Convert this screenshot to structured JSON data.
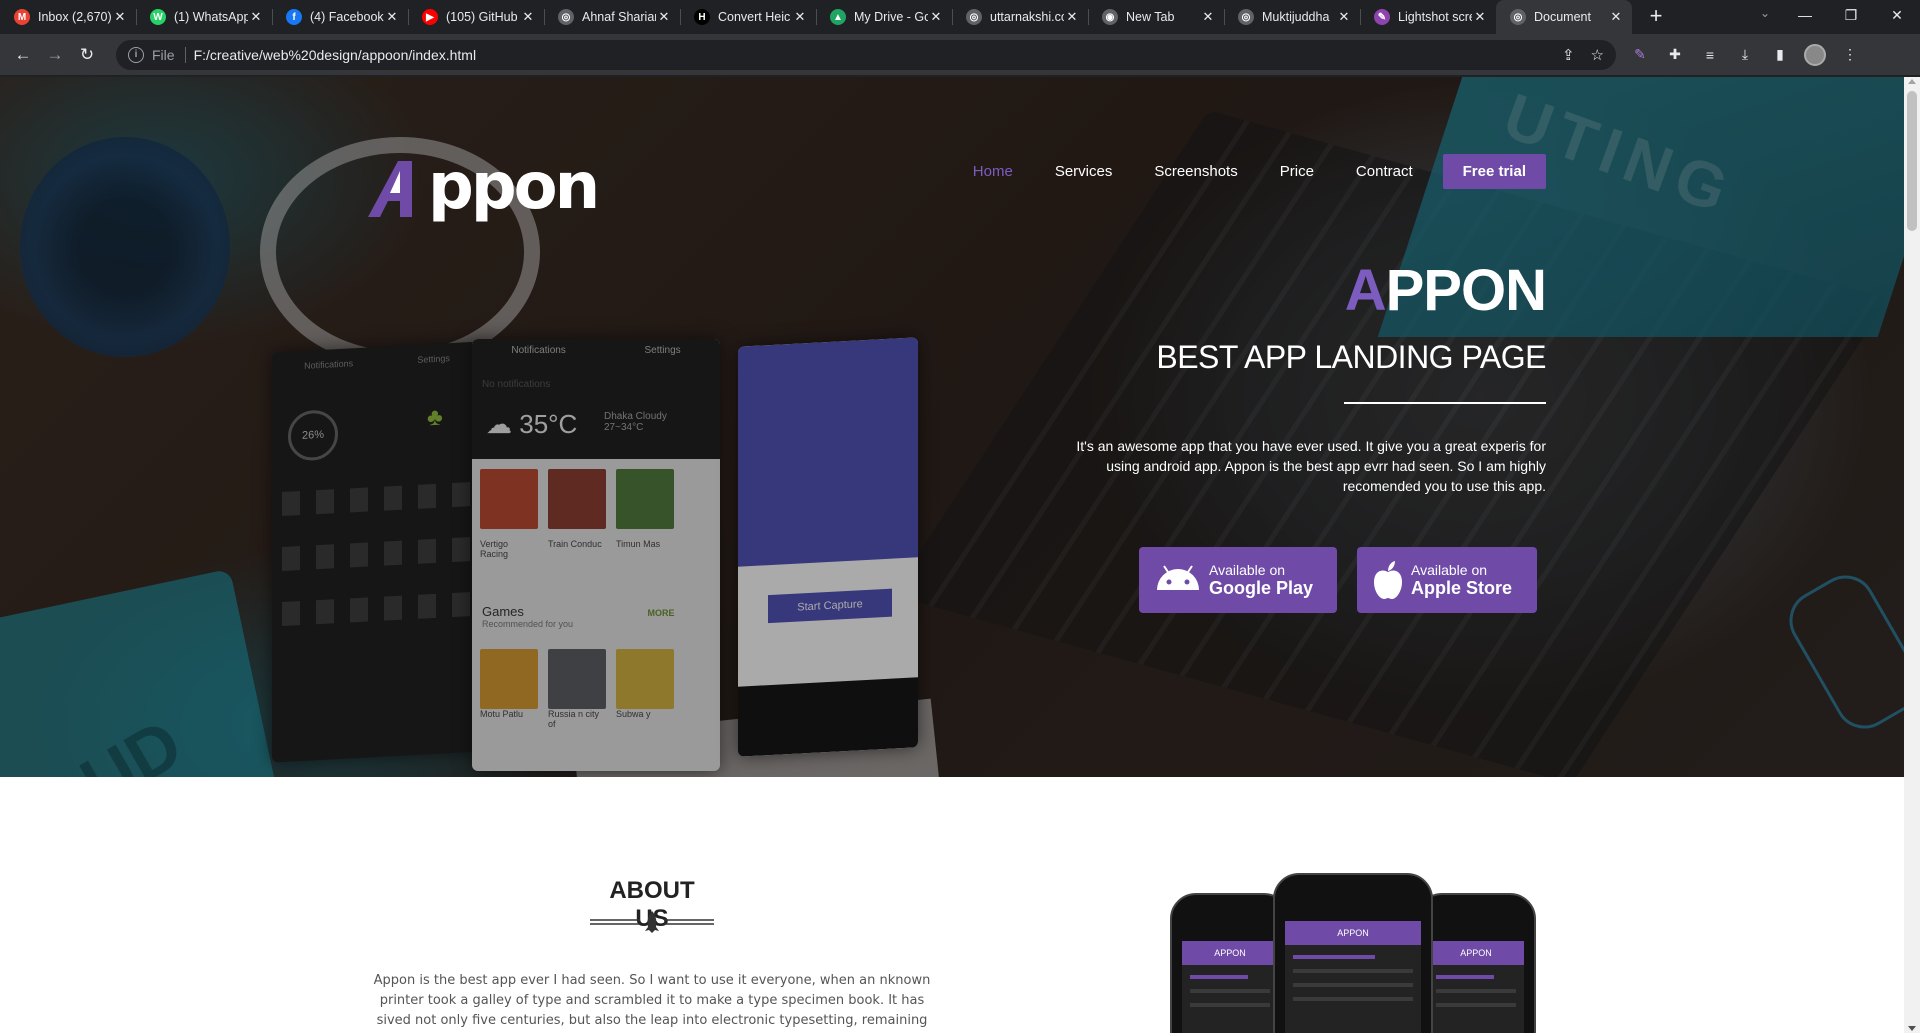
{
  "browser": {
    "tabs": [
      {
        "title": "Inbox (2,670)",
        "favicon": "gmail-icon",
        "color": "#ea4335",
        "glyph": "M"
      },
      {
        "title": "(1) WhatsApp",
        "favicon": "whatsapp-icon",
        "color": "#25d366",
        "glyph": "W"
      },
      {
        "title": "(4) Facebook",
        "favicon": "facebook-icon",
        "color": "#1877f2",
        "glyph": "f"
      },
      {
        "title": "(105) GitHub",
        "favicon": "youtube-icon",
        "color": "#ff0000",
        "glyph": "▶"
      },
      {
        "title": "Ahnaf Shariar",
        "favicon": "globe-icon",
        "color": "#5f6368",
        "glyph": "◎"
      },
      {
        "title": "Convert Heic",
        "favicon": "h-icon",
        "color": "#000000",
        "glyph": "H"
      },
      {
        "title": "My Drive - Go",
        "favicon": "drive-icon",
        "color": "#1fa463",
        "glyph": "▲"
      },
      {
        "title": "uttarnakshi.co",
        "favicon": "globe-icon",
        "color": "#5f6368",
        "glyph": "◎"
      },
      {
        "title": "New Tab",
        "favicon": "chrome-icon",
        "color": "#5f6368",
        "glyph": "◉"
      },
      {
        "title": "Muktijuddha",
        "favicon": "globe-icon",
        "color": "#5f6368",
        "glyph": "◎"
      },
      {
        "title": "Lightshot scre",
        "favicon": "feather-icon",
        "color": "#8e44ad",
        "glyph": "✎"
      },
      {
        "title": "Document",
        "favicon": "globe-icon",
        "color": "#5f6368",
        "glyph": "◎",
        "active": true
      }
    ],
    "url_scheme": "File",
    "url": "F:/creative/web%20design/appoon/index.html"
  },
  "site": {
    "logo": "ppon",
    "nav": [
      "Home",
      "Services",
      "Screenshots",
      "Price",
      "Contract"
    ],
    "cta": "Free trial",
    "hero": {
      "title_accent": "A",
      "title_rest": "PPON",
      "subtitle": "BEST APP LANDING PAGE",
      "description": "It's an awesome app that you have ever used. It give you a great experis for using android app. Appon is the best app evrr had seen. So I am highly recomended you to use this app."
    },
    "stores": {
      "google": {
        "small": "Available on",
        "big": "Google Play"
      },
      "apple": {
        "small": "Available on",
        "big": "Apple Store"
      }
    },
    "about": {
      "title": "ABOUT US",
      "text": "Appon is the best app ever I had seen. So I want to use it everyone, when an nknown printer took a galley of type and scrambled it to make a type specimen book. It has sived not only five centuries, but also the leap into electronic typesetting, remaining"
    },
    "phone_mock": {
      "notifications": "Notifications",
      "settings": "Settings",
      "no_notifications": "No notifications",
      "gauge": "26%",
      "weather": "35°C",
      "city": "Dhaka Cloudy",
      "temp_range": "27~34°C",
      "games": "Games",
      "games_sub": "Recommended for you",
      "more": "MORE",
      "capture": "Start Capture",
      "apps": [
        "Vertigo Racing",
        "Train Conduc",
        "Timun Mas",
        "Motu Patlu",
        "Russia n city of",
        "Subwa y"
      ],
      "iphone_brand": "APPON"
    }
  }
}
